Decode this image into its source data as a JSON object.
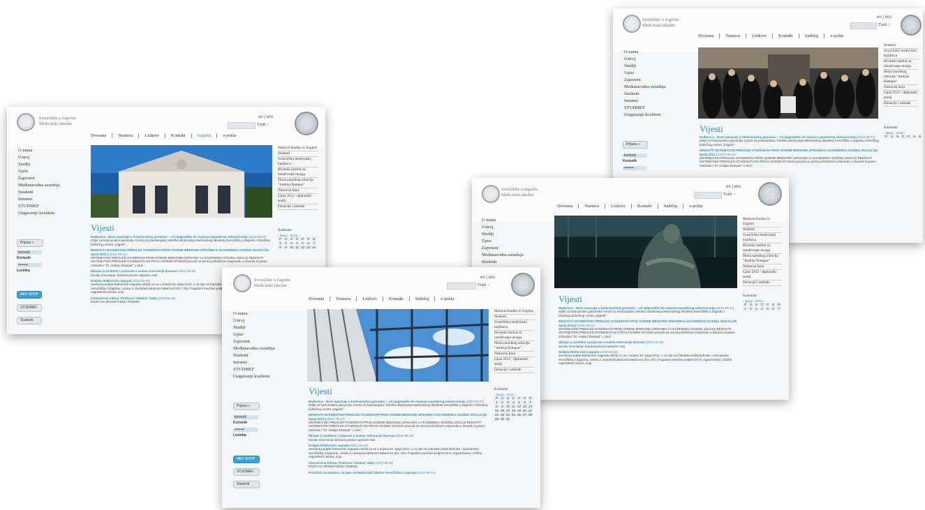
{
  "site": {
    "brand_line1": "Sveučilište u Zagrebu",
    "brand_line2": "Medicinski fakultet",
    "lang": "en | ens",
    "search_label": "Traži >"
  },
  "nav": [
    "Dvorana",
    "Nastava",
    "Liukovi",
    "Kontakt",
    "Sadržaj",
    "e-pošta"
  ],
  "sidebar": [
    "O nama",
    "Ustroj",
    "Studiji",
    "Upisi",
    "Zaposeni",
    "Međunarodna suradnja",
    "Studenti",
    "Intranet",
    "STUDMEF",
    "Osiguranje kvalitete"
  ],
  "login": {
    "button": "Prijava »",
    "user": "korisnik",
    "pass": "••••••••",
    "user_label": "Korisnik",
    "pass_label": "Lozinka"
  },
  "buttons": [
    "MEF SHOP",
    "STUDMEF",
    "Studenti"
  ],
  "main": {
    "title": "Vijesti",
    "news": [
      {
        "headline": "Radionica - Nove spoznaje u funkcionalnoj genomici – od epigenetike do masivno paralelnog sekvenciranja",
        "date": "(2012-09-27)",
        "body": "Odjel za funkcionalnu genomiku Centra za translacijska i klinička istraživanja Medicinskog fakulteta Sveučilišta u Zagrebu i Kliničkog bolničkog centra „Zagreb“"
      },
      {
        "headline": "REDOVITI SISTEMATSKI PREGLED STUDENATA PRVE GODINE MEDICINE UPISANIH U AKADEMSKU GODINU 2011/12 (28. lipanj 2012.)",
        "date": "(2012-09-21)",
        "body": "SISTEMATSKI PREGLED STUDENATA PRVE GODINE MEDICINE (UPISANIH U AKADEMSKU GODINU 2011/12) REDOVITI SISTEMATSKI PREGLED STUDENATA NA PRVOJ GODINI STUDIJA provodi se prema priloženom rasporedu u Zavodu za javno zdravstvo \"Dr. Andrija Štampar\" u Stuč."
      },
      {
        "headline": "Ukinjan je problem s prijavom u sustav rezervacije dvorana",
        "date": "(2012-06-18)",
        "body": "Sustav rezervacije dvorana ponovo ispravno radi."
      },
      {
        "headline": "Dodjela Rektorovih nagrada",
        "date": "(2012-06-15)",
        "body": "Svečana podjela Rektorovih nagrada održat će se u srijedu 20. lipnja 2012. u 11 sati na Fakultetu elektrotehnike i računarstva Sveučilišta u Zagrebu, Unska 3, dvorana kodiranom Maximum (D1 i D2). Pogodom svečane podjele bit će organizirana i izložba nagrađenih radova, koja"
      },
      {
        "headline": "Zvanoćevna tribina: Professor Vladimir Vlady",
        "date": "(2012-06-15)",
        "body": "POZIV NA ZNANSTVENU TRIBINU"
      },
      {
        "headline": "Priručnik za ostatnicu za upis na Medicinski fakultet Sveučilišta u Zagrebu",
        "date": "(2012-06-14)",
        "body": ""
      }
    ]
  },
  "right_links": [
    "Medical Studies in English",
    "Studenti",
    "Sveučilišni medicinski knjižnica",
    "Hrvatski institut za istraživanje mozga",
    "Škola narodnog zdravlja \"Andrija Štampar\"",
    "Nastavna baza",
    "Upisi 2012 - diplomski studij",
    "Donacije i zaklade"
  ],
  "calendar": {
    "title": "Kalendar",
    "month": "‹ lipanj - 2012 ›",
    "days": [
      "P",
      "U",
      "S",
      "Č",
      "P",
      "S",
      "N"
    ],
    "dates": [
      "",
      "",
      "",
      "",
      "1",
      "2",
      "3",
      "4",
      "5",
      "6",
      "7",
      "8",
      "9",
      "10",
      "11",
      "12",
      "13",
      "14",
      "15",
      "16",
      "17",
      "18",
      "19",
      "20",
      "21",
      "22",
      "23",
      "24",
      "25",
      "26",
      "27",
      "28",
      "29",
      "30",
      "31"
    ]
  },
  "colors": {
    "accent": "#2a8fc0",
    "background": "#f4f6f8"
  }
}
